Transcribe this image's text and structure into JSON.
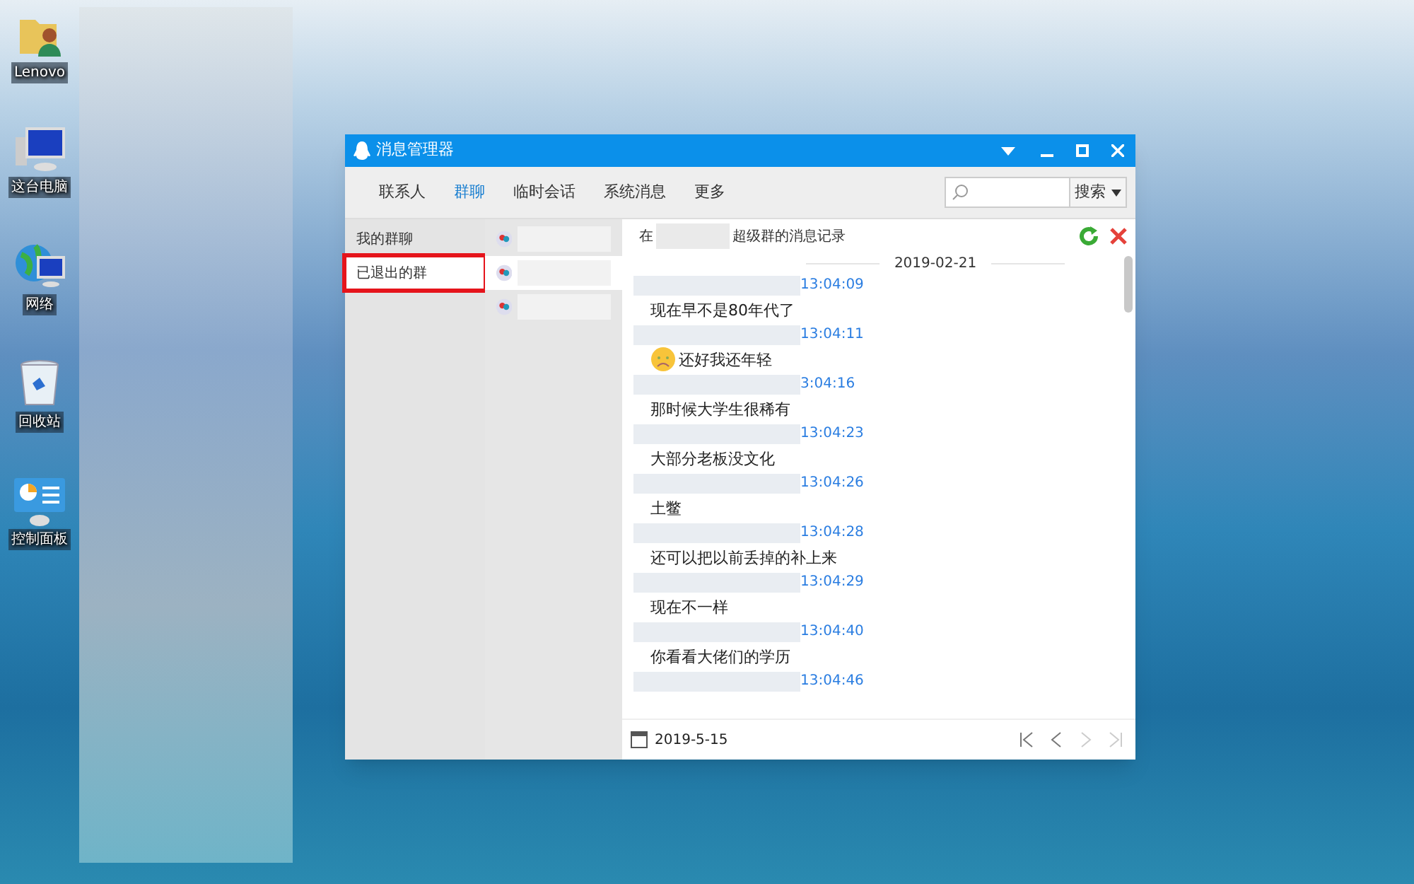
{
  "desktop_icons": [
    {
      "label": "Lenovo",
      "kind": "user-folder"
    },
    {
      "label": "这台电脑",
      "kind": "computer"
    },
    {
      "label": "网络",
      "kind": "network"
    },
    {
      "label": "回收站",
      "kind": "recycle-bin"
    },
    {
      "label": "控制面板",
      "kind": "control-panel"
    }
  ],
  "window": {
    "title": "消息管理器"
  },
  "tabs": [
    {
      "label": "联系人",
      "selected": false
    },
    {
      "label": "群聊",
      "selected": true
    },
    {
      "label": "临时会话",
      "selected": false
    },
    {
      "label": "系统消息",
      "selected": false
    },
    {
      "label": "更多",
      "selected": false
    }
  ],
  "search": {
    "button": "搜索"
  },
  "sidebar": {
    "items": [
      {
        "label": "我的群聊",
        "selected": false,
        "highlighted": false
      },
      {
        "label": "已退出的群",
        "selected": true,
        "highlighted": true
      }
    ]
  },
  "groups": [
    {
      "selected": false
    },
    {
      "selected": true
    },
    {
      "selected": false
    }
  ],
  "chat": {
    "header_prefix": "在",
    "header_suffix": "超级群的消息记录",
    "date": "2019-02-21",
    "messages": [
      {
        "time": "13:04:09",
        "text": "现在早不是80年代了"
      },
      {
        "time": "13:04:11",
        "text": "还好我还年轻",
        "emoji": true
      },
      {
        "time": "3:04:16",
        "text": "那时候大学生很稀有"
      },
      {
        "time": "13:04:23",
        "text": "大部分老板没文化"
      },
      {
        "time": "13:04:26",
        "text": "土鳖"
      },
      {
        "time": "13:04:28",
        "text": "还可以把以前丢掉的补上来"
      },
      {
        "time": "13:04:29",
        "text": "现在不一样"
      },
      {
        "time": "13:04:40",
        "text": "你看看大佬们的学历"
      },
      {
        "time": "13:04:46"
      }
    ]
  },
  "footer": {
    "date": "2019-5-15"
  }
}
